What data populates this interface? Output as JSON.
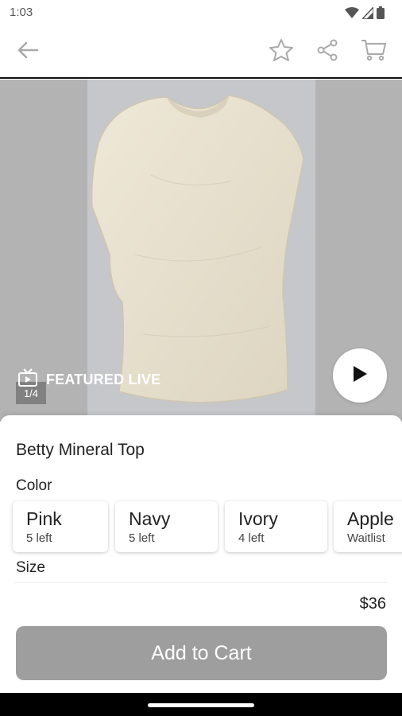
{
  "status_bar": {
    "time": "1:03",
    "icons": [
      "wifi-icon",
      "signal-icon",
      "battery-icon"
    ]
  },
  "app_bar": {
    "icons": [
      "back-arrow-icon",
      "star-icon",
      "share-icon",
      "cart-icon"
    ]
  },
  "hero": {
    "featured_label": "FEATURED LIVE",
    "counter": "1/4",
    "icons": [
      "live-tv-icon",
      "play-icon"
    ]
  },
  "product": {
    "title": "Betty Mineral Top",
    "color_label": "Color",
    "colors": [
      {
        "name": "Pink",
        "stock": "5 left"
      },
      {
        "name": "Navy",
        "stock": "5 left"
      },
      {
        "name": "Ivory",
        "stock": "4 left"
      },
      {
        "name": "Apple",
        "stock": "Waitlist"
      }
    ],
    "size_label": "Size",
    "price": "$36",
    "add_to_cart_label": "Add to Cart"
  },
  "colors": {
    "button_bg": "#9e9e9e",
    "hero_bg": "#b3b3b3",
    "photo_bg": "#c6c7cb",
    "garment": "#ece5d3"
  }
}
